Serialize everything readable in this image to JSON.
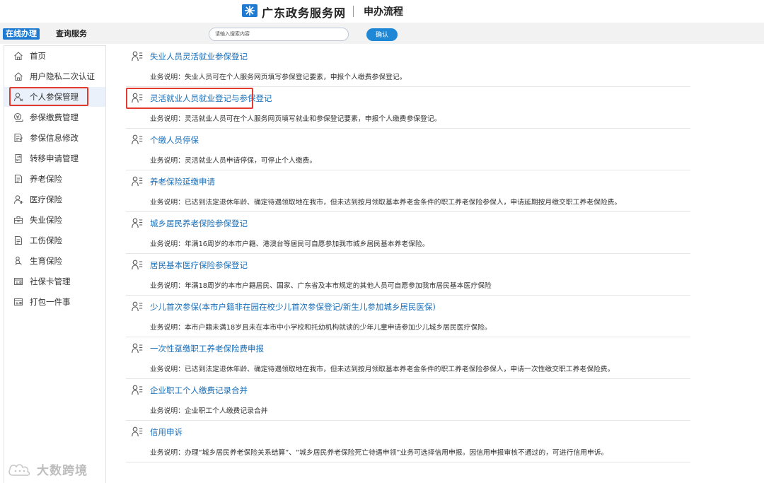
{
  "header": {
    "site_title": "广东政务服务网",
    "page_title": "申办流程",
    "logo_color": "#1f7ad1"
  },
  "topbar": {
    "tab_online": "在线办理",
    "tab_query": "查询服务",
    "search_placeholder": "请输入搜索内容",
    "confirm_label": "确认"
  },
  "sidebar": {
    "items": [
      {
        "label": "首页",
        "icon": "home-icon"
      },
      {
        "label": "用户隐私二次认证",
        "icon": "home-icon"
      },
      {
        "label": "个人参保管理",
        "icon": "person-icon",
        "active": true
      },
      {
        "label": "参保缴费管理",
        "icon": "payment-icon"
      },
      {
        "label": "参保信息修改",
        "icon": "edit-document-icon"
      },
      {
        "label": "转移申请管理",
        "icon": "transfer-icon"
      },
      {
        "label": "养老保险",
        "icon": "document-icon"
      },
      {
        "label": "医疗保险",
        "icon": "person-icon"
      },
      {
        "label": "失业保险",
        "icon": "briefcase-icon"
      },
      {
        "label": "工伤保险",
        "icon": "document-icon"
      },
      {
        "label": "生育保险",
        "icon": "mother-icon"
      },
      {
        "label": "社保卡管理",
        "icon": "card-icon"
      },
      {
        "label": "打包一件事",
        "icon": "card-icon"
      }
    ]
  },
  "entries": [
    {
      "title": "失业人员灵活就业参保登记",
      "desc": "业务说明：失业人员可在个人服务网页填写参保登记要素，申报个人缴费参保登记。"
    },
    {
      "title": "灵活就业人员就业登记与参保登记",
      "desc": "业务说明：灵活就业人员可在个人服务网页填写就业和参保登记要素，申报个人缴费参保登记。"
    },
    {
      "title": "个缴人员停保",
      "desc": "业务说明：灵活就业人员申请停保，可停止个人缴费。"
    },
    {
      "title": "养老保险延缴申请",
      "desc": "业务说明：已达到法定退休年龄、确定待遇领取地在我市，但未达到按月领取基本养老金条件的职工养老保险参保人，申请延期按月缴交职工养老保险费。"
    },
    {
      "title": "城乡居民养老保险参保登记",
      "desc": "业务说明：年满16周岁的本市户籍、港澳台等居民可自愿参加我市城乡居民基本养老保险。"
    },
    {
      "title": "居民基本医疗保险参保登记",
      "desc": "业务说明：年满18周岁的本市户籍居民、国家、广东省及本市规定的其他人员可自愿参加我市居民基本医疗保险"
    },
    {
      "title": "少儿首次参保(本市户籍非在园在校少儿首次参保登记/新生儿参加城乡居民医保)",
      "desc": "业务说明：本市户籍未满18岁且未在本市中小学校和托幼机构就读的少年儿童申请参加少儿城乡居民医疗保险。"
    },
    {
      "title": "一次性趸缴职工养老保险费申报",
      "desc": "业务说明：已达到法定退休年龄、确定待遇领取地在我市，但未达到按月领取基本养老金条件的职工养老保险参保人，申请一次性缴交职工养老保险费。"
    },
    {
      "title": "企业职工个人缴费记录合并",
      "desc": "业务说明：企业职工个人缴费记录合并"
    },
    {
      "title": "信用申诉",
      "desc": "业务说明：办理“城乡居民养老保险关系结算”、“城乡居民养老保险死亡待遇申领”业务可选择信用申报。因信用申报审核不通过的，可进行信用申诉。"
    }
  ],
  "watermark": {
    "text": "大数跨境"
  }
}
